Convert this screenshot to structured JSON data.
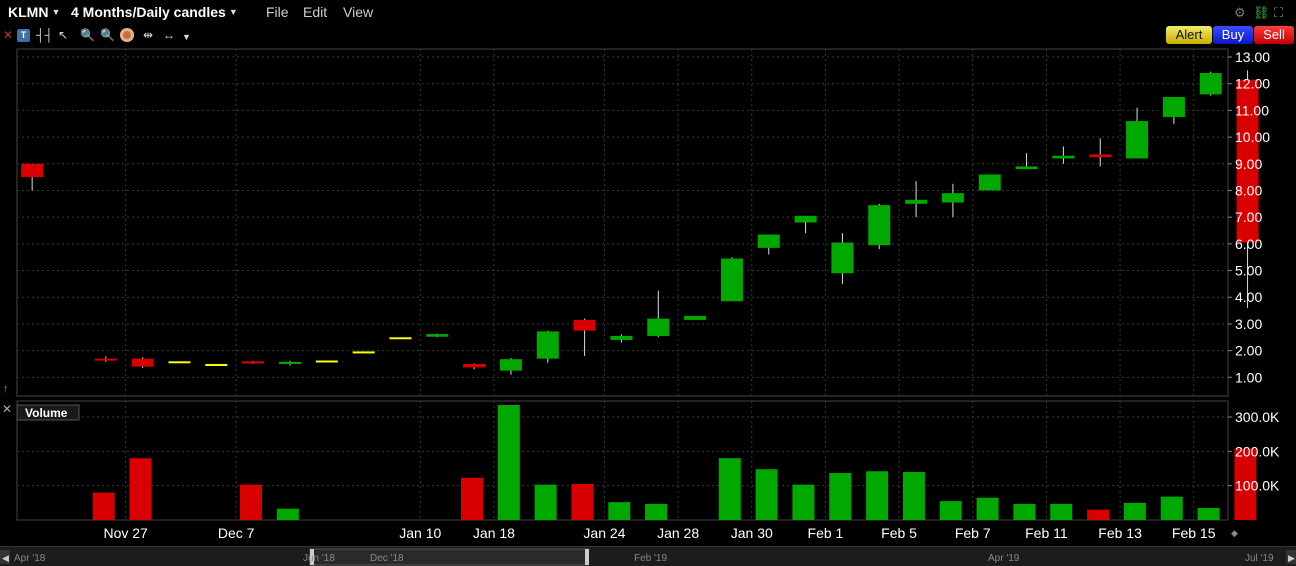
{
  "header": {
    "symbol": "KLMN",
    "period": "4 Months/Daily candles",
    "menus": [
      "File",
      "Edit",
      "View"
    ]
  },
  "toolbar": {
    "alert_label": "Alert",
    "buy_label": "Buy",
    "sell_label": "Sell"
  },
  "volume_label": "Volume",
  "navigator": {
    "labels": [
      "Apr '18",
      "Jun '18",
      "Dec '18",
      "Feb '19",
      "Apr '19",
      "Jul '19"
    ]
  },
  "colors": {
    "up": "#00a800",
    "down": "#d80000",
    "neutral": "#ffff00",
    "grid": "#3a3a3a",
    "background": "#000000"
  },
  "chart_data": [
    {
      "type": "candlestick",
      "title": "KLMN 4 Months/Daily candles",
      "price_axis": {
        "ticks": [
          "13.00",
          "12.00",
          "11.00",
          "10.00",
          "9.00",
          "8.00",
          "7.00",
          "6.00",
          "5.00",
          "4.00",
          "3.00",
          "2.00",
          "1.00"
        ],
        "ylim": [
          0.3,
          13.3
        ]
      },
      "x_labels": [
        "Nov 27",
        "Dec 7",
        "Jan 10",
        "Jan 18",
        "Jan 24",
        "Jan 28",
        "Jan 30",
        "Feb 1",
        "Feb 5",
        "Feb 7",
        "Feb 11",
        "Feb 13",
        "Feb 15"
      ],
      "grid": true,
      "candles": [
        {
          "open": 9.0,
          "close": 8.5,
          "high": 9.0,
          "low": 8.0,
          "color": "down"
        },
        {
          "open": 1.7,
          "close": 1.63,
          "high": 1.78,
          "low": 1.58,
          "color": "down"
        },
        {
          "open": 1.7,
          "close": 1.4,
          "high": 1.75,
          "low": 1.35,
          "color": "down"
        },
        {
          "open": 1.6,
          "close": 1.55,
          "high": 1.6,
          "low": 1.55,
          "color": "neutral"
        },
        {
          "open": 1.5,
          "close": 1.45,
          "high": 1.5,
          "low": 1.45,
          "color": "neutral"
        },
        {
          "open": 1.6,
          "close": 1.52,
          "high": 1.62,
          "low": 1.5,
          "color": "down"
        },
        {
          "open": 1.5,
          "close": 1.58,
          "high": 1.62,
          "low": 1.45,
          "color": "up"
        },
        {
          "open": 1.6,
          "close": 1.63,
          "high": 1.63,
          "low": 1.6,
          "color": "neutral"
        },
        {
          "open": 1.95,
          "close": 1.97,
          "high": 1.97,
          "low": 1.95,
          "color": "neutral"
        },
        {
          "open": 2.47,
          "close": 2.5,
          "high": 2.5,
          "low": 2.47,
          "color": "neutral"
        },
        {
          "open": 2.52,
          "close": 2.62,
          "high": 2.64,
          "low": 2.5,
          "color": "up"
        },
        {
          "open": 1.5,
          "close": 1.37,
          "high": 1.52,
          "low": 1.3,
          "color": "down"
        },
        {
          "open": 1.25,
          "close": 1.68,
          "high": 1.72,
          "low": 1.1,
          "color": "up"
        },
        {
          "open": 1.7,
          "close": 2.72,
          "high": 2.75,
          "low": 1.55,
          "color": "up"
        },
        {
          "open": 3.15,
          "close": 2.75,
          "high": 3.2,
          "low": 1.8,
          "color": "down"
        },
        {
          "open": 2.4,
          "close": 2.55,
          "high": 2.6,
          "low": 2.3,
          "color": "up"
        },
        {
          "open": 2.55,
          "close": 3.2,
          "high": 4.25,
          "low": 2.5,
          "color": "up"
        },
        {
          "open": 3.15,
          "close": 3.3,
          "high": 3.3,
          "low": 3.15,
          "color": "up"
        },
        {
          "open": 3.85,
          "close": 5.45,
          "high": 5.5,
          "low": 3.85,
          "color": "up"
        },
        {
          "open": 5.85,
          "close": 6.35,
          "high": 6.35,
          "low": 5.6,
          "color": "up"
        },
        {
          "open": 6.8,
          "close": 7.05,
          "high": 7.05,
          "low": 6.4,
          "color": "up"
        },
        {
          "open": 4.9,
          "close": 6.05,
          "high": 6.4,
          "low": 4.5,
          "color": "up"
        },
        {
          "open": 5.95,
          "close": 7.45,
          "high": 7.5,
          "low": 5.8,
          "color": "up"
        },
        {
          "open": 7.5,
          "close": 7.65,
          "high": 8.35,
          "low": 7.0,
          "color": "up"
        },
        {
          "open": 7.55,
          "close": 7.9,
          "high": 8.25,
          "low": 7.0,
          "color": "up"
        },
        {
          "open": 8.0,
          "close": 8.6,
          "high": 8.6,
          "low": 8.0,
          "color": "up"
        },
        {
          "open": 8.8,
          "close": 8.9,
          "high": 9.4,
          "low": 8.8,
          "color": "up"
        },
        {
          "open": 9.2,
          "close": 9.3,
          "high": 9.65,
          "low": 9.0,
          "color": "up"
        },
        {
          "open": 9.35,
          "close": 9.25,
          "high": 9.95,
          "low": 8.9,
          "color": "down"
        },
        {
          "open": 9.2,
          "close": 10.6,
          "high": 11.1,
          "low": 9.2,
          "color": "up"
        },
        {
          "open": 10.75,
          "close": 11.5,
          "high": 11.5,
          "low": 10.5,
          "color": "up"
        },
        {
          "open": 11.6,
          "close": 12.4,
          "high": 12.45,
          "low": 11.55,
          "color": "up"
        },
        {
          "open": 12.15,
          "close": 6.05,
          "high": 12.5,
          "low": 3.6,
          "color": "down"
        }
      ]
    },
    {
      "type": "bar",
      "title": "Volume",
      "axis_ticks": [
        "300.0K",
        "200.0K",
        "100.0K"
      ],
      "ylim": [
        0,
        335000
      ],
      "bars": [
        {
          "value": 0,
          "color": "down"
        },
        {
          "value": 0,
          "color": "down"
        },
        {
          "value": 80000,
          "color": "down"
        },
        {
          "value": 180000,
          "color": "down"
        },
        {
          "value": 0,
          "color": "neutral"
        },
        {
          "value": 0,
          "color": "neutral"
        },
        {
          "value": 103000,
          "color": "down"
        },
        {
          "value": 33000,
          "color": "up"
        },
        {
          "value": 0,
          "color": "neutral"
        },
        {
          "value": 0,
          "color": "neutral"
        },
        {
          "value": 0,
          "color": "up"
        },
        {
          "value": 0,
          "color": "up"
        },
        {
          "value": 123000,
          "color": "down"
        },
        {
          "value": 335000,
          "color": "up"
        },
        {
          "value": 103000,
          "color": "up"
        },
        {
          "value": 105000,
          "color": "down"
        },
        {
          "value": 52000,
          "color": "up"
        },
        {
          "value": 47000,
          "color": "up"
        },
        {
          "value": 0,
          "color": "up"
        },
        {
          "value": 180000,
          "color": "up"
        },
        {
          "value": 148000,
          "color": "up"
        },
        {
          "value": 103000,
          "color": "up"
        },
        {
          "value": 137000,
          "color": "up"
        },
        {
          "value": 142000,
          "color": "up"
        },
        {
          "value": 140000,
          "color": "up"
        },
        {
          "value": 55000,
          "color": "up"
        },
        {
          "value": 65000,
          "color": "up"
        },
        {
          "value": 47000,
          "color": "up"
        },
        {
          "value": 47000,
          "color": "up"
        },
        {
          "value": 30000,
          "color": "down"
        },
        {
          "value": 50000,
          "color": "up"
        },
        {
          "value": 68000,
          "color": "up"
        },
        {
          "value": 35000,
          "color": "up"
        },
        {
          "value": 208000,
          "color": "down"
        }
      ]
    }
  ]
}
